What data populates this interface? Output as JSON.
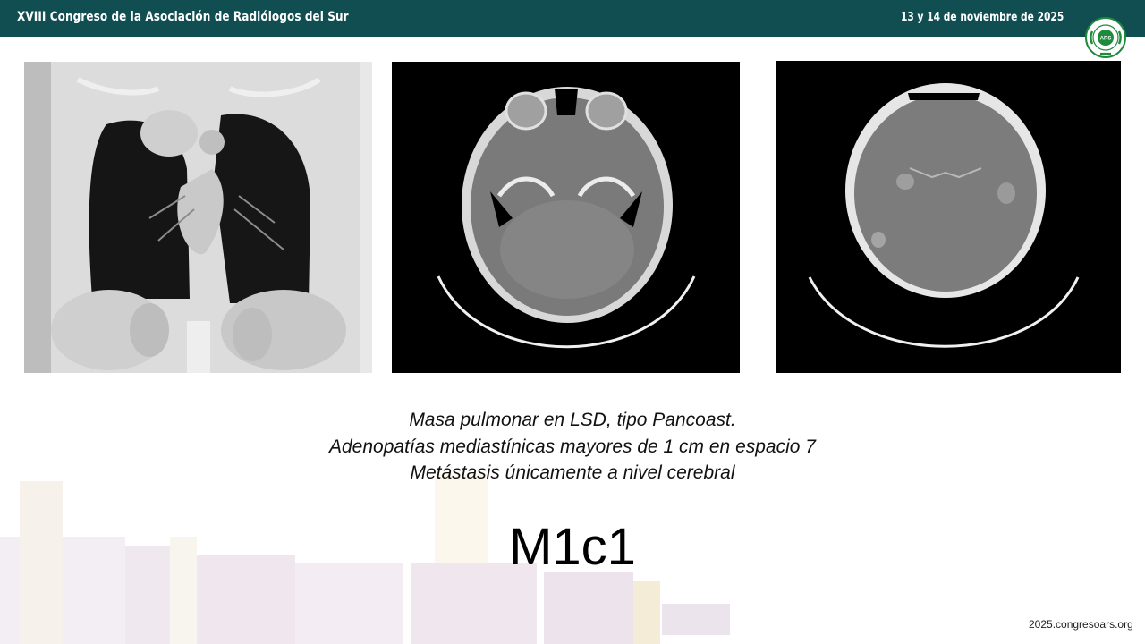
{
  "header": {
    "title": "XVIII Congreso de la Asociación de Radiólogos del Sur",
    "date": "13 y 14 de noviembre de 2025"
  },
  "logo": {
    "center_text": "ARS",
    "ring_text": "ASOCIACIÓN RADIÓLOGOS SUR",
    "color": "#1e8a3c"
  },
  "images": [
    {
      "name": "ct-coronal-chest",
      "kind": "coronal chest CT, lung window"
    },
    {
      "name": "ct-axial-skull-base",
      "kind": "axial head CT with contrast"
    },
    {
      "name": "ct-axial-brain",
      "kind": "axial head CT with contrast"
    }
  ],
  "caption": {
    "line1": "Masa pulmonar en LSD, tipo Pancoast.",
    "line2": "Adenopatías  mediastínicas mayores de 1 cm en espacio 7",
    "line3": "Metástasis únicamente a nivel cerebral"
  },
  "stage": "M1c1",
  "footer": {
    "url": "2025.congresoars.org"
  },
  "colors": {
    "header_bg": "#114e52",
    "text": "#111111"
  }
}
